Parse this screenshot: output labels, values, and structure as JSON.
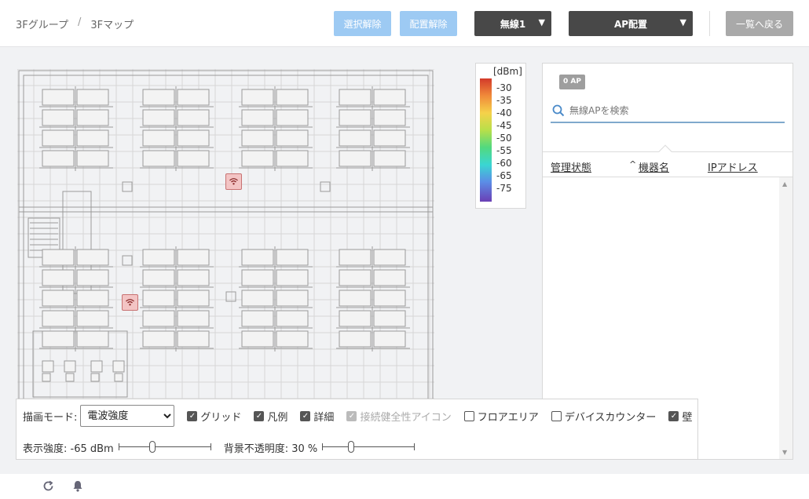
{
  "breadcrumb": {
    "group": "3Fグループ",
    "separator": "/",
    "map": "3Fマップ"
  },
  "toolbar": {
    "deselect_label": "選択解除",
    "unplace_label": "配置解除",
    "radio_select": "無線1",
    "ap_place_select": "AP配置",
    "back_label": "一覧へ戻る"
  },
  "legend": {
    "unit": "[dBm]",
    "ticks": [
      "-30",
      "-35",
      "-40",
      "-45",
      "-50",
      "-55",
      "-60",
      "-65",
      "-75"
    ]
  },
  "panel": {
    "ap_count": "0 AP",
    "search_placeholder": "無線APを検索",
    "columns": {
      "status": "管理状態",
      "sort_indicator": "^",
      "name": "機器名",
      "ip": "IPアドレス"
    }
  },
  "controls": {
    "mode_label": "描画モード:",
    "mode_value": "電波強度",
    "mode_options": [
      "電波強度"
    ],
    "checkboxes": [
      {
        "label": "グリッド",
        "checked": true,
        "disabled": false
      },
      {
        "label": "凡例",
        "checked": true,
        "disabled": false
      },
      {
        "label": "詳細",
        "checked": true,
        "disabled": false
      },
      {
        "label": "接続健全性アイコン",
        "checked": true,
        "disabled": true
      },
      {
        "label": "フロアエリア",
        "checked": false,
        "disabled": false
      },
      {
        "label": "デバイスカウンター",
        "checked": false,
        "disabled": false
      },
      {
        "label": "壁",
        "checked": true,
        "disabled": false
      }
    ],
    "strength_label": "表示強度: -65 dBm",
    "strength_level": 0.35,
    "opacity_label": "背景不透明度: 30 %",
    "opacity_level": 0.3
  },
  "map": {
    "access_points": [
      "wifi-icon",
      "wifi-icon"
    ]
  },
  "footer": {
    "icons": [
      "refresh-icon",
      "bell-icon"
    ]
  }
}
